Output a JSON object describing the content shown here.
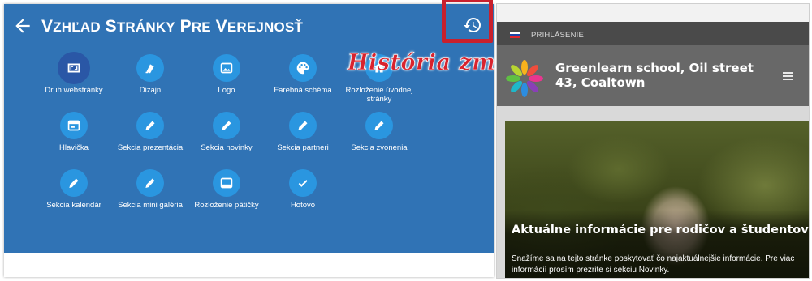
{
  "editor": {
    "title": "Vzhľad stránky pre verejnosť",
    "annotation": "História zmien",
    "tiles": [
      {
        "label": "Druh webstránky",
        "icon": "layout-icon"
      },
      {
        "label": "Dizajn",
        "icon": "design-icon"
      },
      {
        "label": "Logo",
        "icon": "image-icon"
      },
      {
        "label": "Farebná schéma",
        "icon": "palette-icon"
      },
      {
        "label": "Rozloženie úvodnej stránky",
        "icon": "home-layout-icon"
      },
      {
        "label": "Hlavička",
        "icon": "header-icon"
      },
      {
        "label": "Sekcia prezentácia",
        "icon": "pencil-icon"
      },
      {
        "label": "Sekcia novinky",
        "icon": "pencil-icon"
      },
      {
        "label": "Sekcia partneri",
        "icon": "pencil-icon"
      },
      {
        "label": "Sekcia zvonenia",
        "icon": "pencil-icon"
      },
      {
        "label": "Sekcia kalendár",
        "icon": "pencil-icon"
      },
      {
        "label": "Sekcia mini galéria",
        "icon": "pencil-icon"
      },
      {
        "label": "Rozloženie pätičky",
        "icon": "footer-icon"
      },
      {
        "label": "Hotovo",
        "icon": "check-icon"
      }
    ]
  },
  "preview": {
    "login": "PRIHLÁSENIE",
    "school_name": "Greenlearn school, Oil street 43, Coaltown",
    "hero_title": "Aktuálne informácie pre rodičov a študentov",
    "hero_text": "Snažíme sa na tejto stránke poskytovať čo najaktuálnejšie informácie. Pre viac informácií prosím prezrite si sekciu Novinky."
  },
  "colors": {
    "panel_blue": "#3073b5",
    "tile_blue": "#2a96e0",
    "active_tile": "#2a57a6",
    "annotation_red": "#d8232e"
  }
}
